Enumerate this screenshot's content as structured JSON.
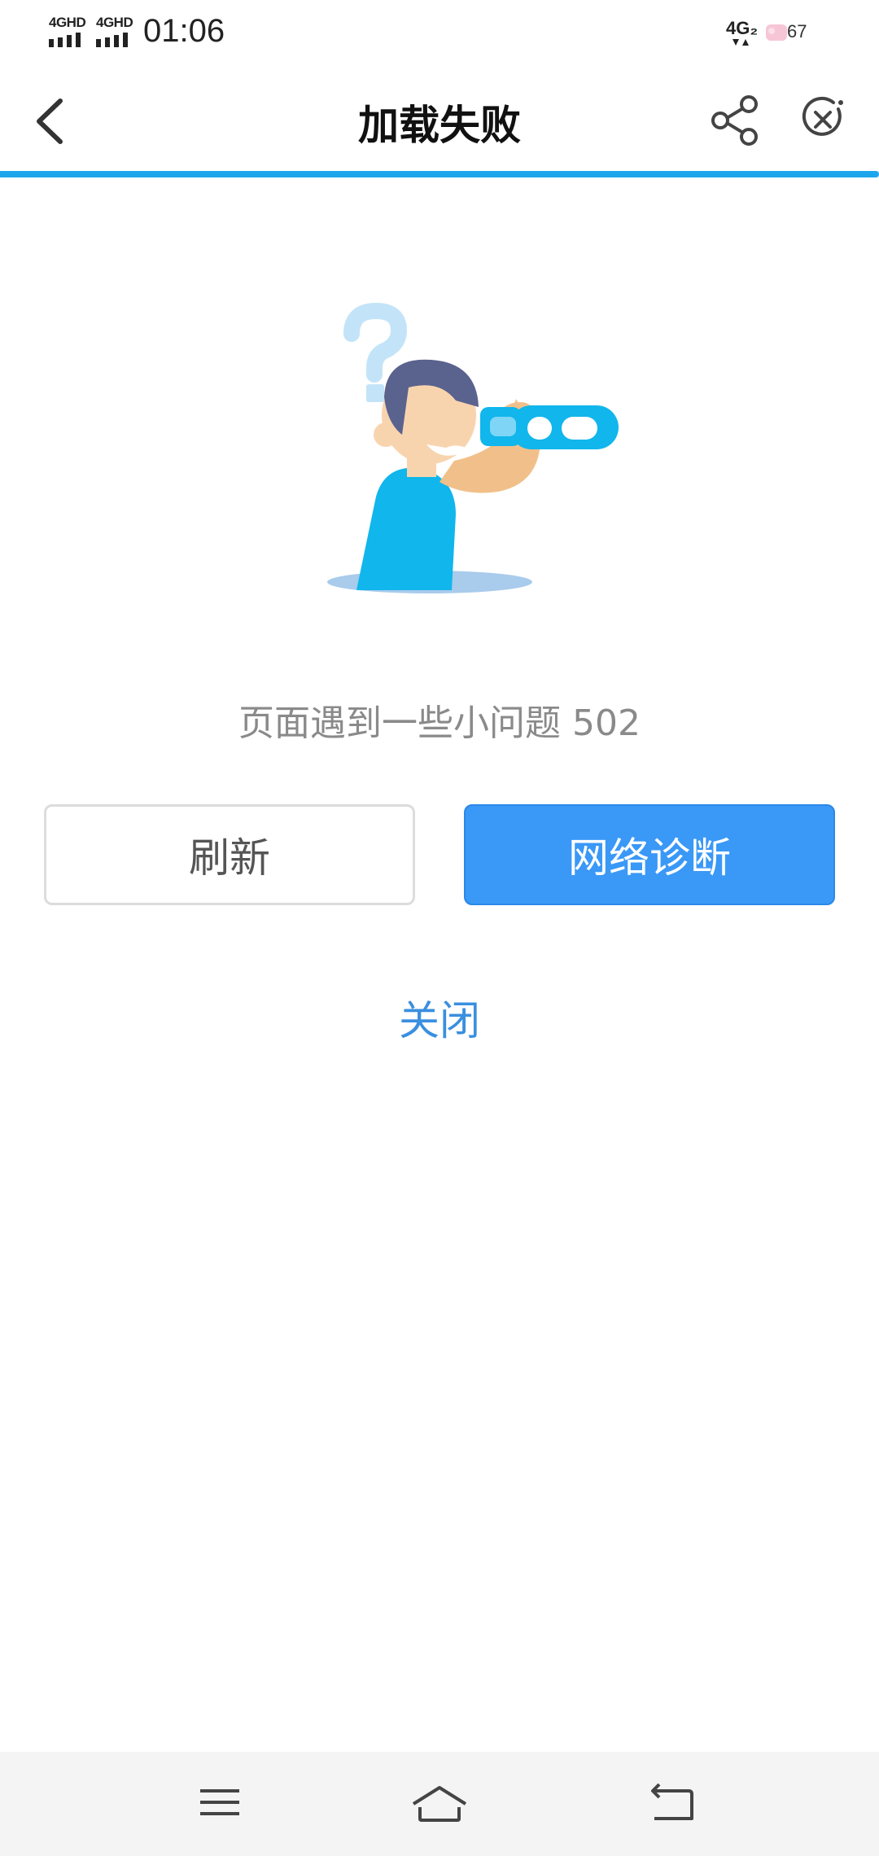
{
  "status_bar": {
    "sim1_label": "4GHD",
    "sim2_label": "4GHD",
    "time": "01:06",
    "network_label": "4G₂",
    "battery_level": "67"
  },
  "title_bar": {
    "title": "加载失败",
    "icons": [
      "chevron-left-icon",
      "share-icon",
      "close-circle-icon"
    ]
  },
  "progress": {
    "fraction": 1.0,
    "color": "#1ea6ec"
  },
  "error": {
    "message": "页面遇到一些小问题 502"
  },
  "actions": {
    "refresh_label": "刷新",
    "diagnose_label": "网络诊断",
    "close_label": "关闭"
  },
  "colors": {
    "accent": "#3a98f7",
    "link": "#3a8fe0",
    "illustration_blue": "#10b6ec"
  },
  "nav_bar": {
    "icons": [
      "menu-icon",
      "home-icon",
      "back-icon"
    ]
  }
}
